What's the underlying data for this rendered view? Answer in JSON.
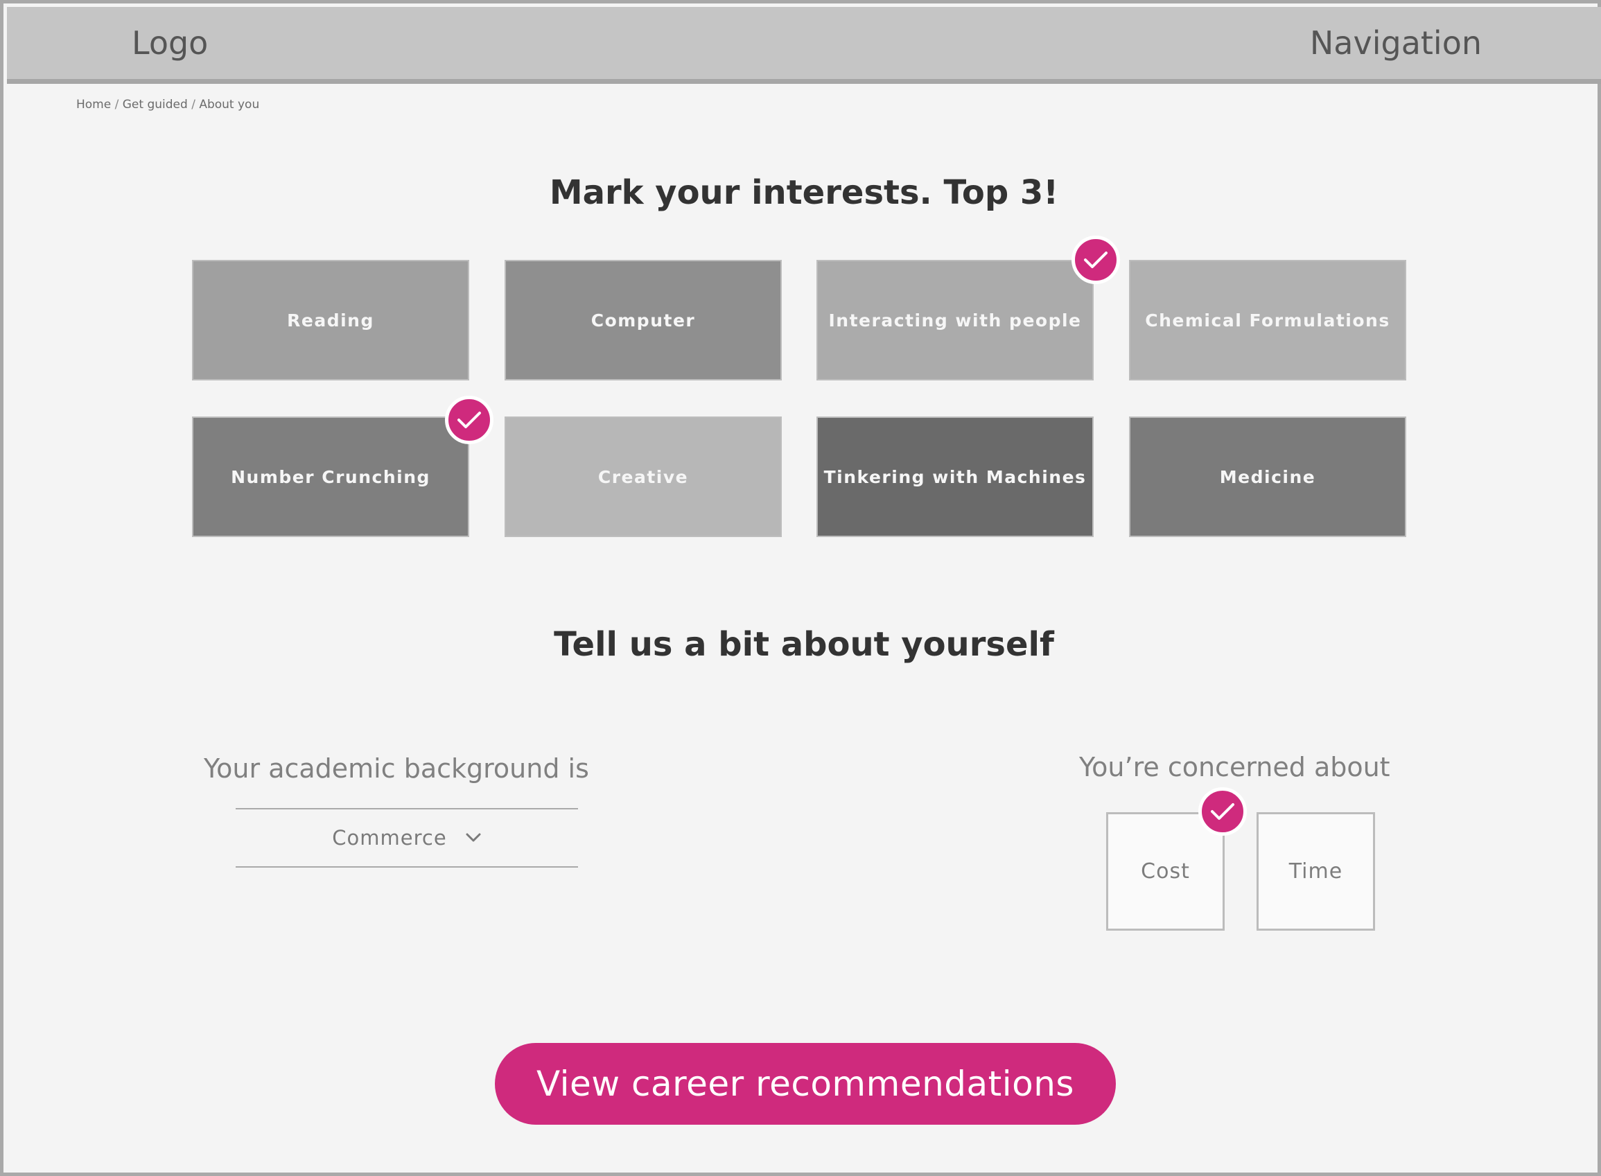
{
  "header": {
    "logo": "Logo",
    "navigation": "Navigation"
  },
  "breadcrumb": [
    "Home",
    "Get guided",
    "About you"
  ],
  "breadcrumb_separator": "/",
  "interests": {
    "title": "Mark your interests. Top 3!",
    "items": [
      {
        "label": "Reading",
        "color": "#a0a0a0",
        "selected": false
      },
      {
        "label": "Computer",
        "color": "#8f8f8f",
        "selected": false
      },
      {
        "label": "Interacting with people",
        "color": "#ababab",
        "selected": true
      },
      {
        "label": "Chemical Formulations",
        "color": "#b1b1b1",
        "selected": false
      },
      {
        "label": "Number Crunching",
        "color": "#7f7f7f",
        "selected": true
      },
      {
        "label": "Creative",
        "color": "#b7b7b7",
        "selected": false
      },
      {
        "label": "Tinkering with Machines",
        "color": "#6a6a6a",
        "selected": false
      },
      {
        "label": "Medicine",
        "color": "#7b7b7b",
        "selected": false
      }
    ]
  },
  "about": {
    "title": "Tell us a bit about yourself",
    "academic_label": "Your academic background is",
    "academic_value": "Commerce",
    "concern_label": "You’re concerned about",
    "concern_options": [
      {
        "label": "Cost",
        "selected": true
      },
      {
        "label": "Time",
        "selected": false
      }
    ]
  },
  "cta": {
    "label": "View career recommendations"
  },
  "colors": {
    "accent": "#cf2a7d",
    "background": "#f4f4f4",
    "header": "#c5c5c5"
  },
  "icons": {
    "selected": "check-icon",
    "dropdown": "chevron-down-icon"
  }
}
